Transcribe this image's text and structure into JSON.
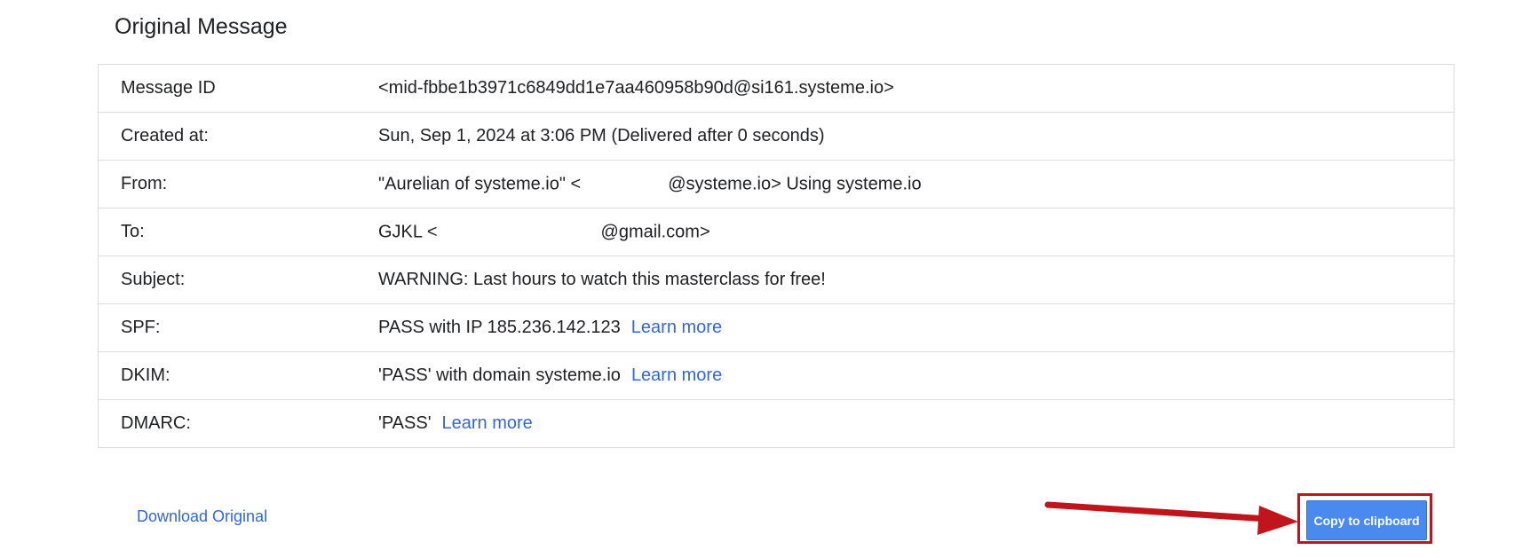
{
  "page": {
    "title": "Original Message"
  },
  "rows": [
    {
      "label": "Message ID",
      "value": "<mid-fbbe1b3971c6849dd1e7aa460958b90d@si161.systeme.io>"
    },
    {
      "label": "Created at:",
      "value": "Sun, Sep 1, 2024 at 3:06 PM (Delivered after 0 seconds)"
    },
    {
      "label": "From:",
      "value_prefix": "\"Aurelian of systeme.io\" <",
      "value_suffix": "@systeme.io> Using systeme.io"
    },
    {
      "label": "To:",
      "value_prefix": "GJKL <",
      "value_suffix": "@gmail.com>"
    },
    {
      "label": "Subject:",
      "value": "WARNING: Last hours to watch this masterclass for free!"
    },
    {
      "label": "SPF:",
      "value": "PASS with IP 185.236.142.123",
      "link": "Learn more"
    },
    {
      "label": "DKIM:",
      "value": "'PASS' with domain systeme.io",
      "link": "Learn more"
    },
    {
      "label": "DMARC:",
      "value": "'PASS'",
      "link": "Learn more"
    }
  ],
  "footer": {
    "download_label": "Download Original",
    "copy_label": "Copy to clipboard"
  },
  "colors": {
    "message_id": "#3c8a3e",
    "link": "#3367d6",
    "button_bg": "#4a89ee",
    "annotation": "#c0151c"
  },
  "icons": {
    "annotation_arrow": "arrow-right-icon"
  }
}
